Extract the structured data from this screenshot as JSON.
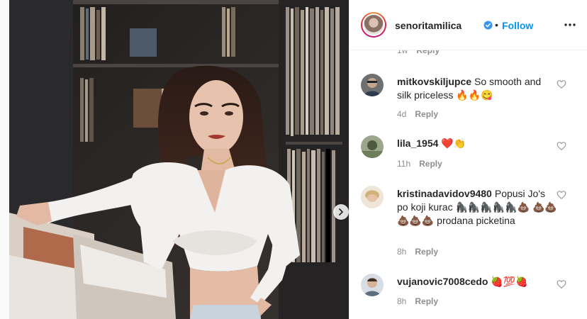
{
  "post": {
    "username": "senoritamilica",
    "separator": "•",
    "follow_label": "Follow",
    "icons": {
      "verified": "verified-badge-icon",
      "more": "more-options-icon",
      "next": "chevron-right-icon",
      "like": "heart-outline-icon"
    },
    "colors": {
      "accent": "#0095f6",
      "text": "#262626",
      "muted": "#8e8e8e"
    }
  },
  "partial_comment": {
    "time": "1w",
    "reply_label": "Reply"
  },
  "comments": [
    {
      "user": "mitkovskiljupce",
      "text": "So smooth and silk priceless 🔥🔥😋",
      "time": "4d",
      "reply_label": "Reply"
    },
    {
      "user": "lila_1954",
      "text": "❤️👏",
      "time": "11h",
      "reply_label": "Reply"
    },
    {
      "user": "kristinadavidov9480",
      "text": "Popusi Jo's po koji kurac 🦍🦍🦍🦍🦍💩 💩💩💩💩💩 prodana picketina",
      "time": "8h",
      "reply_label": "Reply"
    },
    {
      "user": "vujanovic7008cedo",
      "text": "🍓💯🍓",
      "time": "8h",
      "reply_label": "Reply"
    }
  ]
}
